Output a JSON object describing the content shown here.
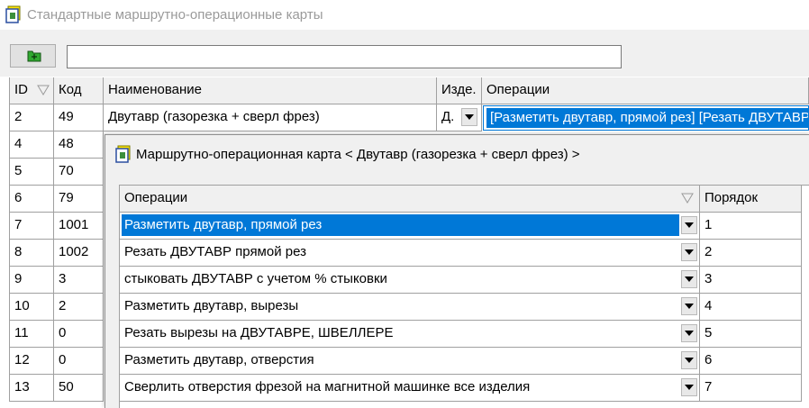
{
  "window": {
    "title": "Стандартные маршрутно-операционные карты"
  },
  "toolbar": {
    "search_value": ""
  },
  "grid": {
    "columns": [
      "ID",
      "Код",
      "Наименование",
      "Изде.",
      "Операции"
    ],
    "rows": [
      {
        "id": "2",
        "code": "49",
        "name": "Двутавр (газорезка + сверл фрез)",
        "product": "Д.",
        "ops": "[Разметить двутавр,  прямой рез] [Резать ДВУТАВР  прямой рез]"
      },
      {
        "id": "4",
        "code": "48"
      },
      {
        "id": "5",
        "code": "70"
      },
      {
        "id": "6",
        "code": "79"
      },
      {
        "id": "7",
        "code": "1001"
      },
      {
        "id": "8",
        "code": "1002"
      },
      {
        "id": "9",
        "code": "3"
      },
      {
        "id": "10",
        "code": "2"
      },
      {
        "id": "11",
        "code": "0"
      },
      {
        "id": "12",
        "code": "0"
      },
      {
        "id": "13",
        "code": "50"
      }
    ]
  },
  "dialog": {
    "title": "Маршрутно-операционная карта < Двутавр (газорезка + сверл фрез) >",
    "columns": [
      "Операции",
      "Порядок"
    ],
    "rows": [
      {
        "op": "Разметить двутавр,  прямой рез",
        "order": "1"
      },
      {
        "op": "Резать ДВУТАВР  прямой рез",
        "order": "2"
      },
      {
        "op": "стыковать  ДВУТАВР с учетом % стыковки",
        "order": "3"
      },
      {
        "op": "Разметить двутавр, вырезы",
        "order": "4"
      },
      {
        "op": "Резать вырезы на ДВУТАВРЕ, ШВЕЛЛЕРЕ",
        "order": "5"
      },
      {
        "op": "Разметить двутавр, отверстия",
        "order": "6"
      },
      {
        "op": "Сверлить отверстия фрезой на магнитной машинке  все изделия",
        "order": "7"
      }
    ]
  },
  "colors": {
    "selection": "#0078d7",
    "header_bg": "#f0f0f0",
    "grid_line": "#a0a0a0"
  }
}
